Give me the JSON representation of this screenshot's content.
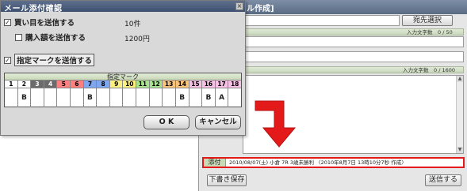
{
  "background_window": {
    "title_partial": "ル作成]",
    "address_button": "宛先選択",
    "subject_counter": "入力文字数　0 / 50",
    "body_counter": "入力文字数　0 / 1600",
    "attach_label": "添付",
    "attach_text": "2010/08/07(土) 小倉 7R 3歳未勝利 〈2010年8月7日 13時10分7秒 作成〉",
    "draft_button": "下書き保存",
    "send_button": "送信する",
    "highlight_color": "#e41a1a"
  },
  "dialog": {
    "title": "メール添付確認",
    "close_label": "×",
    "options": [
      {
        "label": "買い目を送信する",
        "checked": true,
        "count": "10件"
      },
      {
        "label": "購入額を送信する",
        "checked": false,
        "count": "1200円"
      },
      {
        "label": "指定マークを送信する",
        "checked": true
      }
    ],
    "marks_header": "指定マーク",
    "mark_numbers": [
      "1",
      "2",
      "3",
      "4",
      "5",
      "6",
      "7",
      "8",
      "9",
      "10",
      "11",
      "12",
      "13",
      "14",
      "15",
      "16",
      "17",
      "18"
    ],
    "mark_colors": [
      "#ffffff",
      "#ffffff",
      "#6b6b6b",
      "#6b6b6b",
      "#ff8080",
      "#ff8080",
      "#7fa7f0",
      "#7fa7f0",
      "#fbf080",
      "#fbf080",
      "#a7e28c",
      "#a7e28c",
      "#f8c27b",
      "#f8c27b",
      "#f6c1e4",
      "#f6c1e4",
      "#f6c1e4",
      "#f6c1e4"
    ],
    "mark_text_colors": [
      "#000000",
      "#000000",
      "#ffffff",
      "#ffffff",
      "#000000",
      "#000000",
      "#000000",
      "#000000",
      "#000000",
      "#000000",
      "#000000",
      "#000000",
      "#000000",
      "#000000",
      "#000000",
      "#000000",
      "#000000",
      "#000000"
    ],
    "mark_values": [
      "",
      "B",
      "",
      "",
      "",
      "",
      "B",
      "",
      "",
      "",
      "",
      "",
      "",
      "B",
      "",
      "B",
      "A",
      ""
    ],
    "ok_button": "O K",
    "cancel_button": "キャンセル"
  }
}
